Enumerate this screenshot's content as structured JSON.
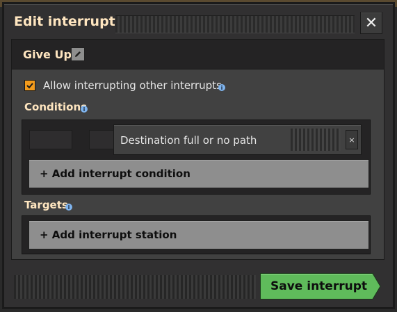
{
  "window": {
    "title": "Edit interrupt",
    "close_glyph": "✕"
  },
  "interrupt": {
    "name": "Give Up"
  },
  "options": {
    "allow_interrupting_label": "Allow interrupting other interrupts",
    "allow_interrupting_checked": true
  },
  "conditions": {
    "title": "Conditions",
    "items": [
      {
        "label": "Destination full or no path"
      }
    ],
    "remove_glyph": "×",
    "add_label": "+ Add interrupt condition"
  },
  "targets": {
    "title": "Targets",
    "add_label": "+ Add interrupt station"
  },
  "footer": {
    "save_label": "Save interrupt"
  },
  "colors": {
    "accent_orange": "#f39b1c",
    "heading_text": "#ffe6c0",
    "save_green": "#5fbb5b",
    "info_blue": "#7fb4ee"
  },
  "icons": {
    "close": "close-icon",
    "edit": "pencil-icon",
    "check": "check-icon",
    "info": "info-icon"
  }
}
